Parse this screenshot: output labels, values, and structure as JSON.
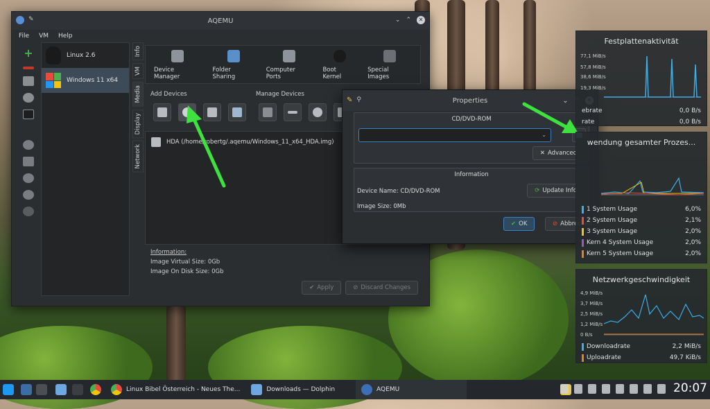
{
  "aqemu": {
    "title": "AQEMU",
    "menu": [
      "File",
      "VM",
      "Help"
    ],
    "vms": [
      {
        "name": "Linux 2.6",
        "icon": "tux-icon"
      },
      {
        "name": "Windows 11 x64",
        "icon": "windows-icon",
        "selected": true
      }
    ],
    "tabs": [
      "Info",
      "VM",
      "Media",
      "Display",
      "Network"
    ],
    "top_icons": [
      "Device Manager",
      "Folder Sharing",
      "Computer Ports",
      "Boot Kernel",
      "Special Images"
    ],
    "add_devices_label": "Add Devices",
    "manage_devices_label": "Manage Devices",
    "device_entry": "HDA (/home/robertg/.aqemu/Windows_11_x64_HDA.img)",
    "info_label": "Information:",
    "info_virtual": "Image Virtual Size: 0Gb",
    "info_disk": "Image On Disk Size: 0Gb",
    "apply": "Apply",
    "discard": "Discard Changes"
  },
  "properties": {
    "title": "Properties",
    "group1_title": "CD/DVD-ROM",
    "advanced": "Advanced",
    "group2_title": "Information",
    "device_name": "Device Name: CD/DVD-ROM",
    "image_size": "Image Size: 0Mb",
    "update_info": "Update Info",
    "ok": "OK",
    "cancel": "Abbrechen"
  },
  "disk_widget": {
    "title": "Festplattenaktivität",
    "y_ticks": [
      "77,1 MiB/s",
      "57,8 MiB/s",
      "38,6 MiB/s",
      "19,3 MiB/s"
    ],
    "rows": [
      {
        "label": "ebrate",
        "value": "0,0 B/s"
      },
      {
        "label": "rate",
        "value": "0,0 B/s"
      }
    ]
  },
  "cpu_widget": {
    "title": "wendung gesamter Prozes...",
    "rows": [
      {
        "label": "1 System Usage",
        "value": "6,0%",
        "color": "#3daee9"
      },
      {
        "label": "2 System Usage",
        "value": "2,1%",
        "color": "#e74c3c"
      },
      {
        "label": "3 System Usage",
        "value": "2,0%",
        "color": "#f1c40f"
      },
      {
        "label": "Kern 4 System Usage",
        "value": "2,0%",
        "color": "#9b59b6"
      },
      {
        "label": "Kern 5 System Usage",
        "value": "2,0%",
        "color": "#e67e22"
      }
    ]
  },
  "net_widget": {
    "title": "Netzwerkgeschwindigkeit",
    "y_ticks": [
      "4,9 MiB/s",
      "3,7 MiB/s",
      "2,5 MiB/s",
      "1,2 MiB/s",
      "0 B/s"
    ],
    "rows": [
      {
        "label": "Downloadrate",
        "value": "2,2 MiB/s",
        "color": "#3daee9"
      },
      {
        "label": "Uploadrate",
        "value": "49,7 KiB/s",
        "color": "#e67e22"
      }
    ]
  },
  "taskbar": {
    "tasks": [
      {
        "label": "Linux Bibel Österreich - Neues The...",
        "icon": "browser-icon"
      },
      {
        "label": "Downloads — Dolphin",
        "icon": "folder-icon"
      },
      {
        "label": "AQEMU",
        "icon": "aqemu-icon",
        "active": true
      }
    ],
    "clock": "20:07"
  }
}
